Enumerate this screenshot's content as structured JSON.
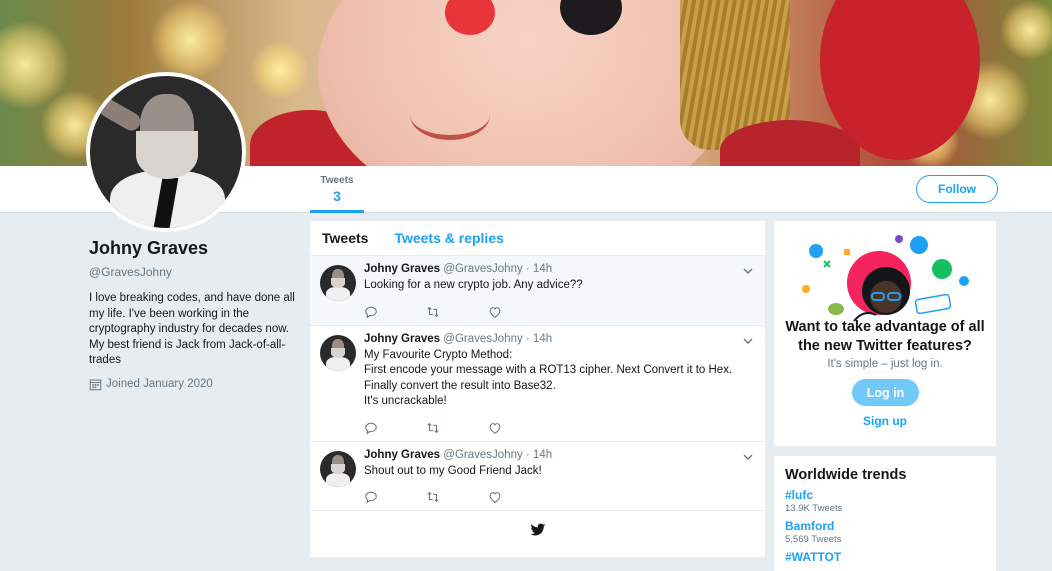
{
  "profile": {
    "name": "Johny Graves",
    "handle": "@GravesJohny",
    "bio": "I love breaking codes, and have done all my life. I've been working in the cryptography industry for decades now. My best friend is Jack from Jack-of-all-trades",
    "joined": "Joined January 2020"
  },
  "nav": {
    "tweets_label": "Tweets",
    "tweets_count": "3",
    "follow_label": "Follow"
  },
  "timeline": {
    "tabs": [
      {
        "label": "Tweets",
        "active": true
      },
      {
        "label": "Tweets & replies",
        "active": false
      }
    ],
    "tweets": [
      {
        "name": "Johny Graves",
        "meta": "@GravesJohny · 14h",
        "lines": [
          "Looking for a new crypto job. Any advice??"
        ]
      },
      {
        "name": "Johny Graves",
        "meta": "@GravesJohny · 14h",
        "lines": [
          "My Favourite Crypto Method:",
          "First encode your message with a ROT13 cipher. Next Convert it to Hex. Finally convert the result into Base32.",
          "It's uncrackable!"
        ]
      },
      {
        "name": "Johny Graves",
        "meta": "@GravesJohny · 14h",
        "lines": [
          "Shout out to my Good Friend Jack!"
        ]
      }
    ]
  },
  "signup_card": {
    "title": "Want to take advantage of all the new Twitter features?",
    "subtitle": "It's simple – just log in.",
    "login_label": "Log in",
    "signup_label": "Sign up"
  },
  "trends": {
    "title": "Worldwide trends",
    "items": [
      {
        "tag": "#lufc",
        "count": "13.9K Tweets"
      },
      {
        "tag": "Bamford",
        "count": "5,569 Tweets"
      },
      {
        "tag": "#WATTOT",
        "count": ""
      }
    ]
  },
  "colors": {
    "accent": "#1da1f2",
    "background": "#e6ecf0",
    "muted_text": "#657786",
    "login_button": "#71c9f8"
  },
  "icons": [
    "calendar-icon",
    "reply-icon",
    "retweet-icon",
    "like-icon",
    "chevron-down-icon",
    "twitter-bird-icon"
  ]
}
